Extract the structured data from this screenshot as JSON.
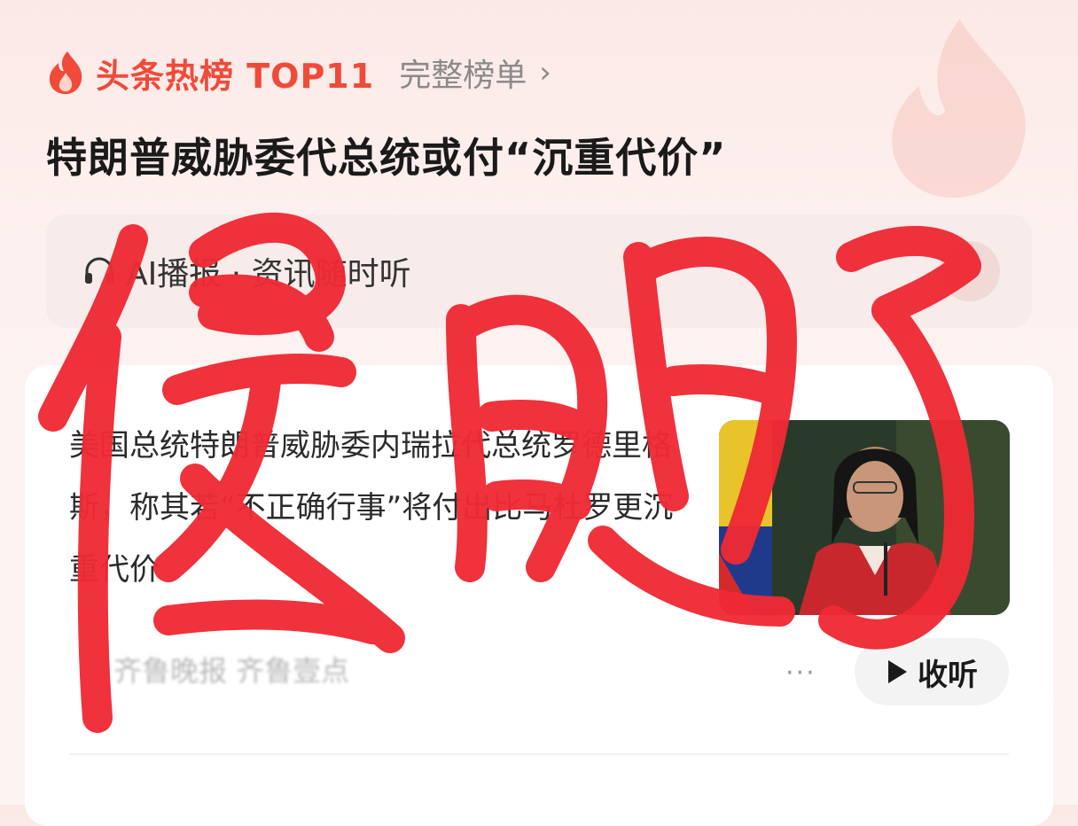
{
  "header": {
    "hot_title": "头条热榜 TOP11",
    "full_list_label": "完整榜单",
    "accent_color": "#f04a3a"
  },
  "headline": "特朗普威胁委代总统或付“沉重代价”",
  "ai_bar": {
    "label": "AI播报 · 资讯随时听"
  },
  "card": {
    "summary": "美国总统特朗普威胁委内瑞拉代总统罗德里格斯，称其若“不正确行事”将付出比马杜罗更沉重代价",
    "source": "齐鲁晚报 齐鲁壹点",
    "listen_label": "收听",
    "more_icon": "more-dots-icon",
    "play_icon": "play-icon"
  },
  "overlay": {
    "handwritten_text": "傻眼了",
    "ink_color": "#ef2a34"
  }
}
